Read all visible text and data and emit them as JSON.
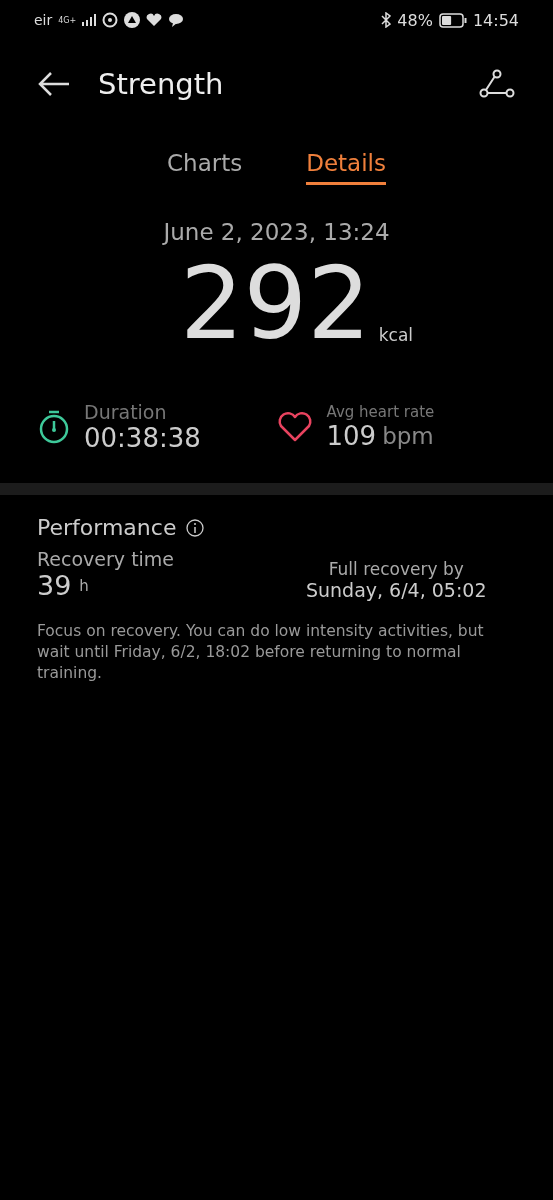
{
  "status_bar": {
    "carrier": "eir",
    "network": "4G+",
    "battery": "48%",
    "time": "14:54"
  },
  "header": {
    "title": "Strength"
  },
  "tabs": [
    {
      "label": "Charts",
      "selected": false
    },
    {
      "label": "Details",
      "selected": true
    }
  ],
  "date": "June 2, 2023, 13:24",
  "calories": {
    "value": "292",
    "unit": "kcal"
  },
  "stats": [
    {
      "kind": "duration",
      "label": "Duration",
      "value": "00:38:38"
    },
    {
      "kind": "heart",
      "label": "Avg heart rate",
      "value": "109",
      "unit": "bpm"
    }
  ],
  "performance": {
    "title": "Performance",
    "recovery_label": "Recovery time",
    "recovery_value": "39",
    "recovery_unit": "h",
    "full_label": "Full recovery by",
    "full_value": "Sunday, 6/4, 05:02",
    "note": "Focus on recovery. You can do low intensity activities, but wait until Friday, 6/2, 18:02 before returning to normal training."
  }
}
